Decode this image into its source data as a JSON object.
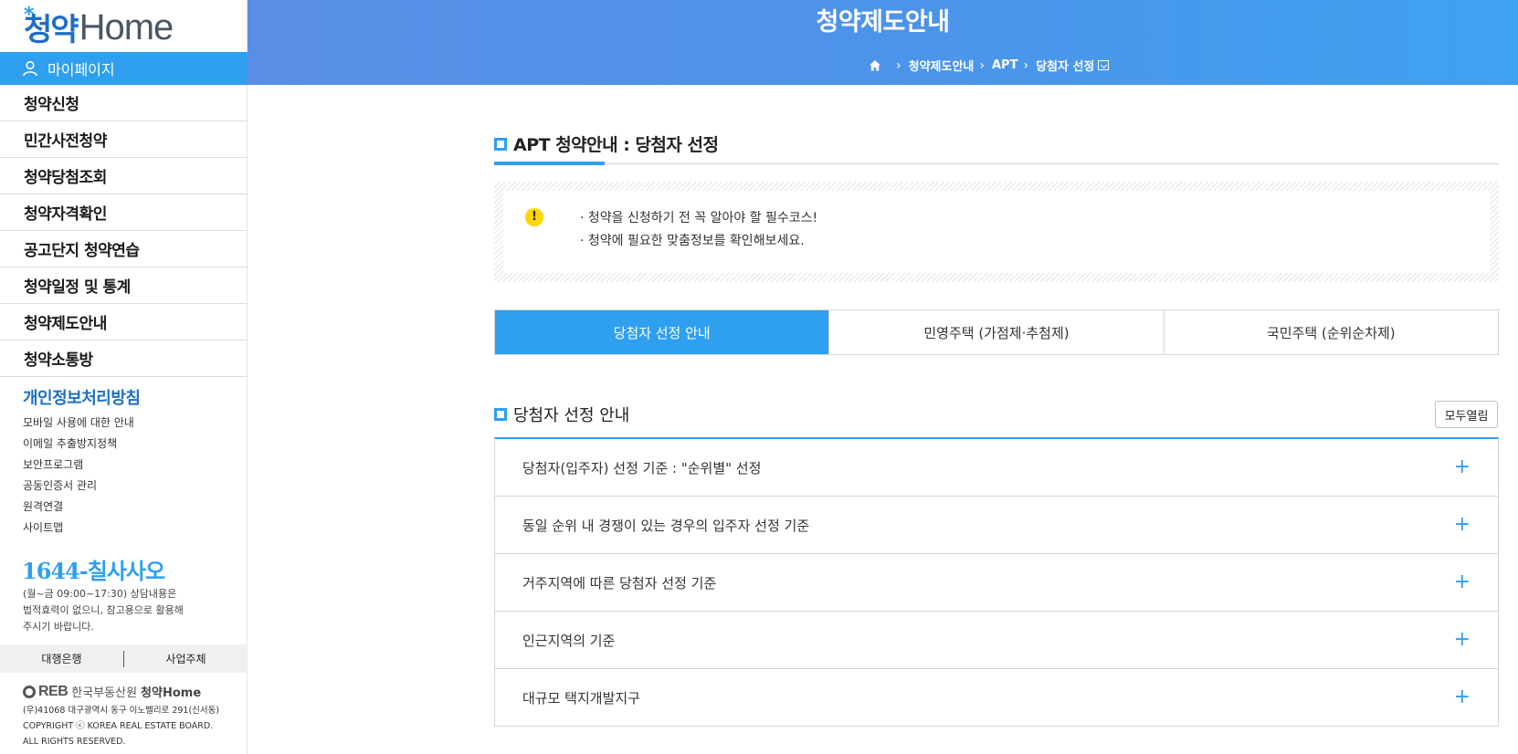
{
  "logo": {
    "star": "*",
    "korean": "청약",
    "english": "Home"
  },
  "sidebar": {
    "mypage_label": "마이페이지",
    "menu": [
      "청약신청",
      "민간사전청약",
      "청약당첨조회",
      "청약자격확인",
      "공고단지 청약연습",
      "청약일정 및 통계",
      "청약제도안내",
      "청약소통방"
    ],
    "privacy_label": "개인정보처리방침",
    "links": [
      "모바일 사용에 대한 안내",
      "이메일 추출방지정책",
      "보안프로그램",
      "공동인증서 관리",
      "원격연결",
      "사이트맵"
    ],
    "phone": "1644-칠사사오",
    "phone_desc": [
      "(월~금 09:00~17:30) 상담내용은",
      "법적효력이 없으니, 참고용으로 활용해",
      "주시기 바랍니다."
    ],
    "bank_buttons": [
      "대행은행",
      "사업주체"
    ],
    "footer_org": "한국부동산원",
    "footer_brand": "청약Home",
    "footer_reb": "REB",
    "address": [
      "(우)41068 대구광역시 동구 이노밸리로 291(신서동)",
      "COPYRIGHT ⓒ KOREA REAL ESTATE BOARD.",
      "ALL RIGHTS RESERVED."
    ]
  },
  "header": {
    "title": "청약제도안내",
    "breadcrumb": [
      "청약제도안내",
      "APT",
      "당첨자 선정"
    ]
  },
  "main": {
    "section_title": "APT 청약안내 : 당첨자 선정",
    "notice_lines": [
      "· 청약을 신청하기 전 꼭 알아야 할 필수코스!",
      "· 청약에 필요한 맞춤정보를 확인해보세요."
    ],
    "tabs": [
      {
        "label": "당첨자 선정 안내",
        "active": true
      },
      {
        "label": "민영주택 (가점제·추첨제)",
        "active": false
      },
      {
        "label": "국민주택 (순위순차제)",
        "active": false
      }
    ],
    "sub_title": "당첨자 선정 안내",
    "open_all_label": "모두열림",
    "accordion": [
      "당첨자(입주자) 선정 기준 : \"순위별\" 선정",
      "동일 순위 내 경쟁이 있는 경우의 입주자 선정 기준",
      "거주지역에 따른 당첨자 선정 기준",
      "인근지역의 기준",
      "대규모 택지개발지구"
    ]
  },
  "colors": {
    "accent": "#2f9ff0",
    "brand_blue": "#1e6fc6",
    "warning": "#ffd600"
  },
  "icons": {
    "user": "user-icon",
    "home": "home-icon",
    "warning": "warning-icon",
    "expand": "plus-icon"
  }
}
